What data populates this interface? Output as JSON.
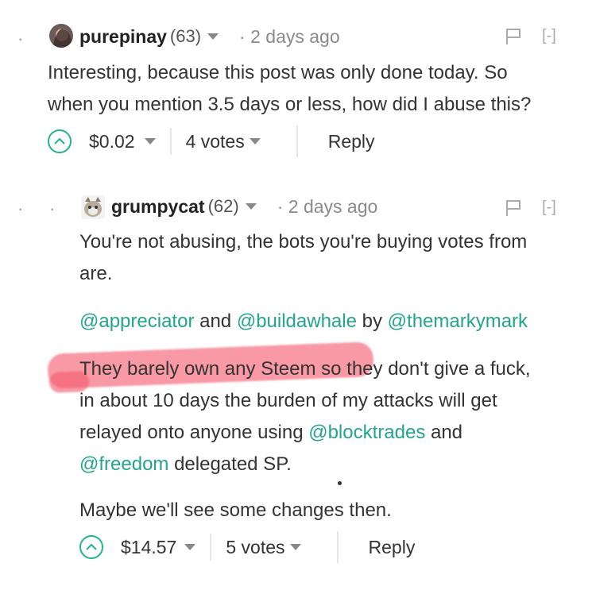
{
  "comment1": {
    "author": "purepinay",
    "rep": "(63)",
    "time": "· 2 days ago",
    "collapse": "[-]",
    "line1": "Interesting, because this post was only done today. So",
    "line2": "when you mention 3.5 days or less, how did I abuse this?",
    "payout": "$0.02",
    "votes": "4 votes",
    "reply": "Reply"
  },
  "comment2": {
    "author": "grumpycat",
    "rep": "(62)",
    "time": "· 2 days ago",
    "collapse": "[-]",
    "p1_line1": "You're not abusing, the bots you're buying votes from",
    "p1_line2": "are.",
    "p2_link1": "@appreciator",
    "p2_and": "and",
    "p2_link2": "@buildawhale",
    "p2_by": "by",
    "p2_link3": "@themarkymark",
    "p3_line1": "They barely own any Steem so they don't give a fuck,",
    "p3_line2": "in about 10 days the burden of my attacks will get",
    "p3_line3_pre": "relayed onto anyone using",
    "p3_line3_link": "@blocktrades",
    "p3_line3_post": "and",
    "p3_line4_link": "@freedom",
    "p3_line4_post": "delegated SP.",
    "p4": "Maybe we'll see some changes then.",
    "payout": "$14.57",
    "votes": "5 votes",
    "reply": "Reply"
  },
  "colors": {
    "link": "#22a58c",
    "upvote": "#22b38f",
    "highlight": "#f45a6e"
  }
}
